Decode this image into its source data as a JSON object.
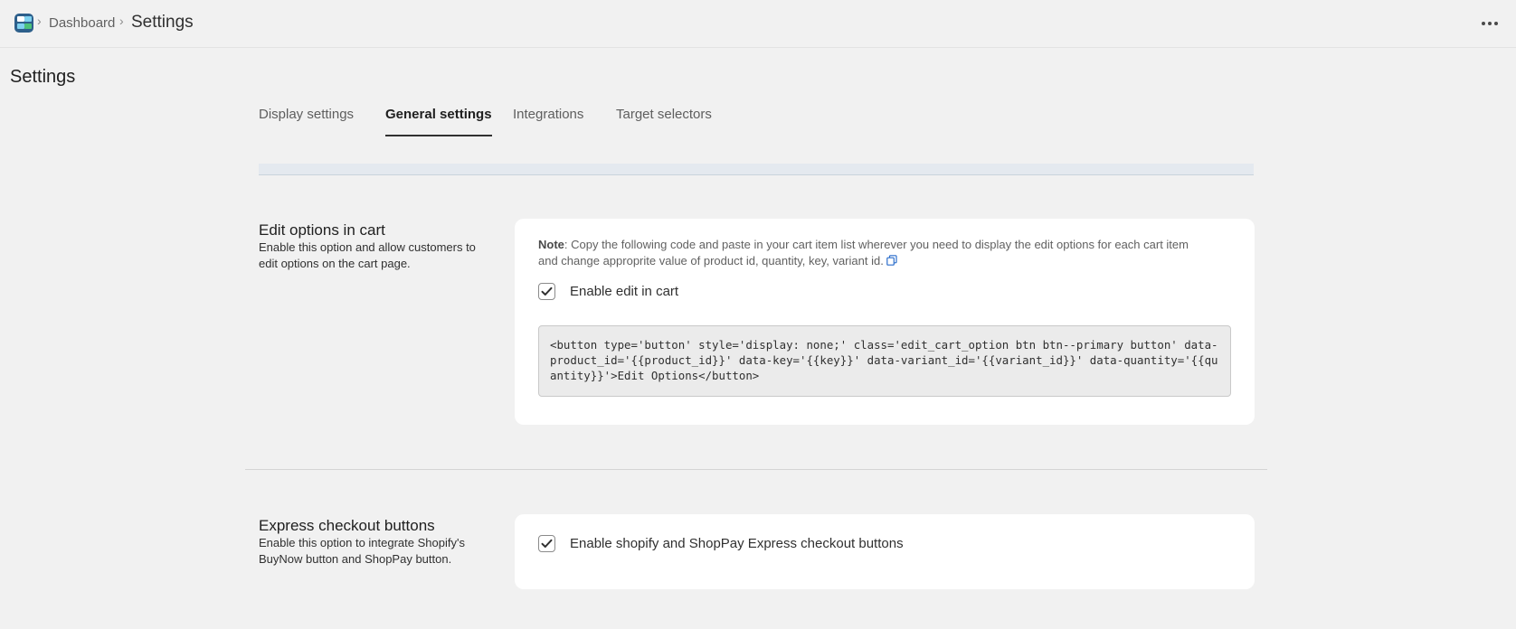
{
  "breadcrumb": {
    "parent": "Dashboard",
    "current": "Settings",
    "separator": "›"
  },
  "header": {
    "more_icon": "more-horizontal-icon"
  },
  "page": {
    "title": "Settings"
  },
  "tabs": [
    {
      "label": "Display settings",
      "active": false
    },
    {
      "label": "General settings",
      "active": true
    },
    {
      "label": "Integrations",
      "active": false
    },
    {
      "label": "Target selectors",
      "active": false
    }
  ],
  "sections": {
    "edit_cart": {
      "title": "Edit options in cart",
      "description": "Enable this option and allow customers to edit options on the cart page.",
      "note_label": "Note",
      "note_text": ": Copy the following code and paste in your cart item list wherever you need to display the edit options for each cart item and change approprite value of product id, quantity, key, variant id.",
      "copy_icon": "copy-icon",
      "checkbox_label": "Enable edit in cart",
      "checked": true,
      "code": "<button type='button' style='display: none;' class='edit_cart_option btn btn--primary button' data-product_id='{{product_id}}' data-key='{{key}}' data-variant_id='{{variant_id}}' data-quantity='{{quantity}}'>Edit Options</button>"
    },
    "express_checkout": {
      "title": "Express checkout buttons",
      "description": "Enable this option to integrate Shopify's BuyNow button and ShopPay button.",
      "checkbox_label": "Enable shopify and ShopPay Express checkout buttons",
      "checked": true
    }
  },
  "colors": {
    "background": "#f1f1f1",
    "card": "#ffffff",
    "accent": "#2c6ecb",
    "info_strip": "#e4e9ef"
  }
}
